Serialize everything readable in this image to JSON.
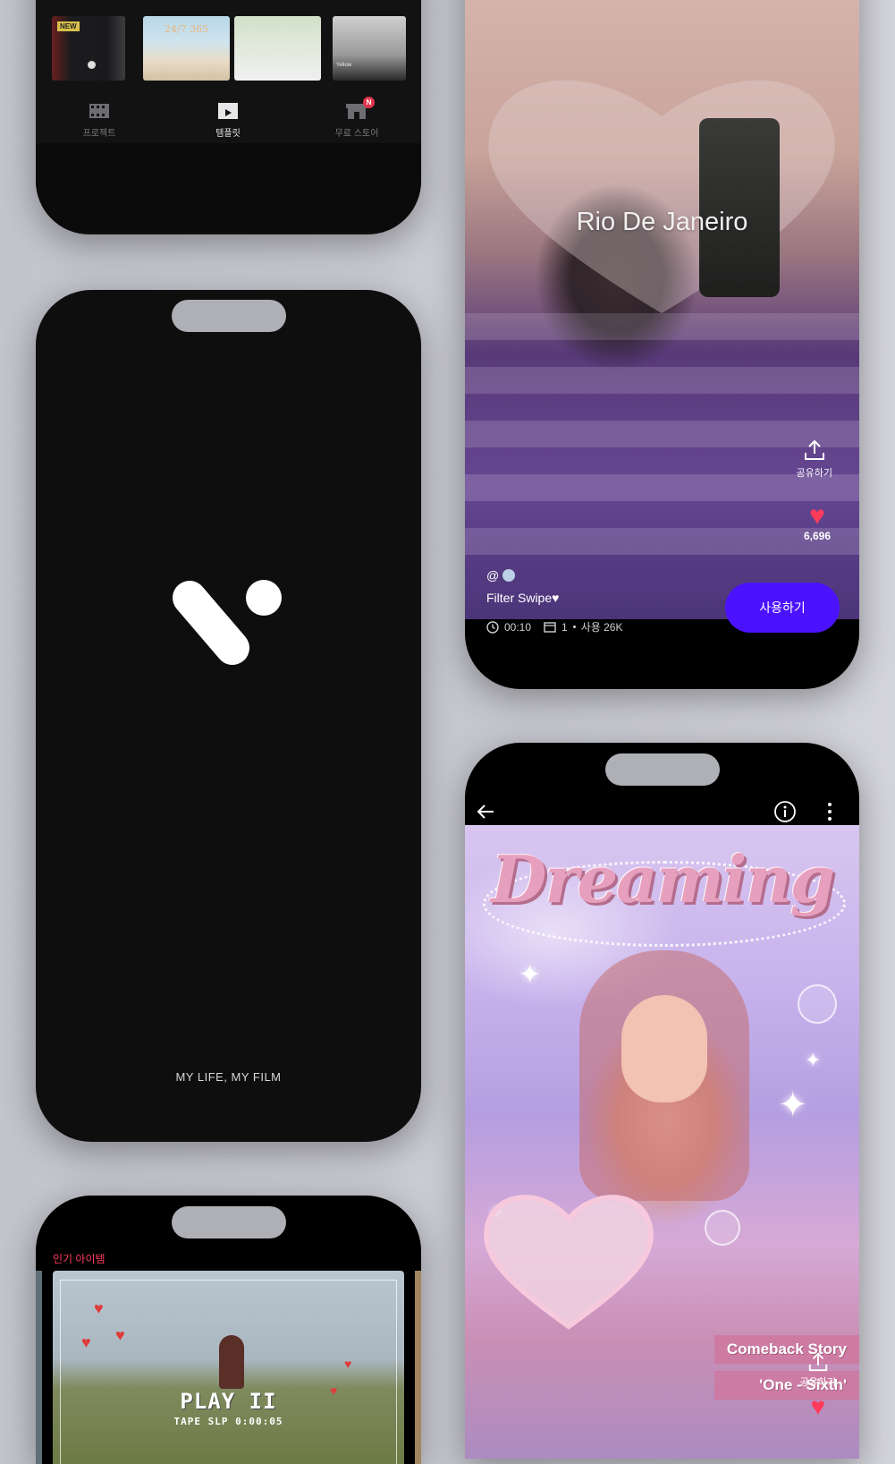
{
  "home_screen": {
    "new_badge": "NEW",
    "thumb_titles": [
      "24/7 365",
      "Yellow"
    ],
    "tabs": [
      {
        "label": "프로젝트",
        "icon": "film-icon"
      },
      {
        "label": "템플릿",
        "icon": "clapper-icon"
      },
      {
        "label": "무료 스토어",
        "icon": "store-icon",
        "badge": "N"
      }
    ],
    "active_tab": "템플릿"
  },
  "splash_screen": {
    "tagline": "MY LIFE, MY FILM",
    "logo": "vllo-v-logo"
  },
  "popular_screen": {
    "section_title": "인기 아이템",
    "card_overlay_title": "PLAY II",
    "card_overlay_sub": "TAPE    SLP   0:00:05"
  },
  "template_detail": {
    "overlay_title": "Rio De Janeiro",
    "share_label": "공유하기",
    "like_count": "6,696",
    "author_prefix": "@",
    "template_name": "Filter Swipe♥",
    "use_button": "사용하기",
    "duration": "00:10",
    "clips": "1",
    "usage": "사용 26K"
  },
  "dreaming_detail": {
    "art_title": "Dreaming",
    "labels": [
      "Comeback Story",
      "'One - Sixth'"
    ],
    "share_label": "공유하기"
  },
  "colors": {
    "accent_purple": "#4b12ff",
    "like_red": "#ff3b5c",
    "badge_red": "#e2344b"
  }
}
